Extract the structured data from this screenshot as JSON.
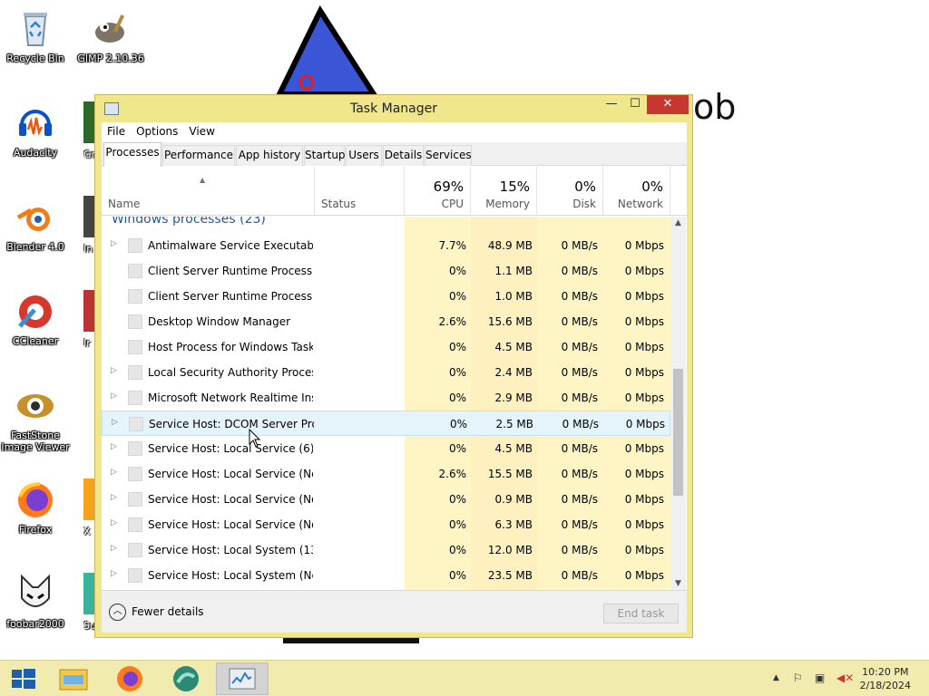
{
  "desktop": {
    "icons": [
      {
        "label": "Recycle Bin"
      },
      {
        "label": "GIMP 2.10.36"
      },
      {
        "label": "Audacity"
      },
      {
        "label": "Blender 4.0"
      },
      {
        "label": "CCleaner"
      },
      {
        "label": "FastStone Image Viewer"
      },
      {
        "label": "Firefox"
      },
      {
        "label": "foobar2000"
      }
    ],
    "partial_labels": [
      "Gr",
      "In",
      "Ir",
      "X",
      "Sup"
    ],
    "background_text": "ob"
  },
  "window": {
    "title": "Task Manager",
    "controls": {
      "minimize": "—",
      "maximize": "☐",
      "close": "✕"
    },
    "menu": [
      "File",
      "Options",
      "View"
    ],
    "tabs": [
      "Processes",
      "Performance",
      "App history",
      "Startup",
      "Users",
      "Details",
      "Services"
    ],
    "active_tab": "Processes",
    "columns": {
      "name": "Name",
      "status": "Status",
      "cpu": {
        "pct": "69%",
        "label": "CPU"
      },
      "memory": {
        "pct": "15%",
        "label": "Memory"
      },
      "disk": {
        "pct": "0%",
        "label": "Disk"
      },
      "network": {
        "pct": "0%",
        "label": "Network"
      }
    },
    "group_title": "Windows processes (23)",
    "processes": [
      {
        "name": "Antimalware Service Executable",
        "expand": true,
        "cpu": "7.7%",
        "mem": "48.9 MB",
        "disk": "0 MB/s",
        "net": "0 Mbps"
      },
      {
        "name": "Client Server Runtime Process",
        "expand": false,
        "cpu": "0%",
        "mem": "1.1 MB",
        "disk": "0 MB/s",
        "net": "0 Mbps"
      },
      {
        "name": "Client Server Runtime Process",
        "expand": false,
        "cpu": "0%",
        "mem": "1.0 MB",
        "disk": "0 MB/s",
        "net": "0 Mbps"
      },
      {
        "name": "Desktop Window Manager",
        "expand": false,
        "cpu": "2.6%",
        "mem": "15.6 MB",
        "disk": "0 MB/s",
        "net": "0 Mbps"
      },
      {
        "name": "Host Process for Windows Tasks",
        "expand": false,
        "cpu": "0%",
        "mem": "4.5 MB",
        "disk": "0 MB/s",
        "net": "0 Mbps"
      },
      {
        "name": "Local Security Authority Process",
        "expand": true,
        "cpu": "0%",
        "mem": "2.4 MB",
        "disk": "0 MB/s",
        "net": "0 Mbps"
      },
      {
        "name": "Microsoft Network Realtime Ins...",
        "expand": true,
        "cpu": "0%",
        "mem": "2.9 MB",
        "disk": "0 MB/s",
        "net": "0 Mbps"
      },
      {
        "name": "Service Host: DCOM Server Proc...",
        "expand": true,
        "cpu": "0%",
        "mem": "2.5 MB",
        "disk": "0 MB/s",
        "net": "0 Mbps"
      },
      {
        "name": "Service Host: Local Service (6)",
        "expand": true,
        "cpu": "0%",
        "mem": "4.5 MB",
        "disk": "0 MB/s",
        "net": "0 Mbps"
      },
      {
        "name": "Service Host: Local Service (Net...",
        "expand": true,
        "cpu": "2.6%",
        "mem": "15.5 MB",
        "disk": "0 MB/s",
        "net": "0 Mbps"
      },
      {
        "name": "Service Host: Local Service (No I...",
        "expand": true,
        "cpu": "0%",
        "mem": "0.9 MB",
        "disk": "0 MB/s",
        "net": "0 Mbps"
      },
      {
        "name": "Service Host: Local Service (No ...",
        "expand": true,
        "cpu": "0%",
        "mem": "6.3 MB",
        "disk": "0 MB/s",
        "net": "0 Mbps"
      },
      {
        "name": "Service Host: Local System (13)",
        "expand": true,
        "cpu": "0%",
        "mem": "12.0 MB",
        "disk": "0 MB/s",
        "net": "0 Mbps"
      },
      {
        "name": "Service Host: Local System (Net...",
        "expand": true,
        "cpu": "0%",
        "mem": "23.5 MB",
        "disk": "0 MB/s",
        "net": "0 Mbps"
      }
    ],
    "selected_row": "Service Host: DCOM Server Proc...",
    "footer": {
      "fewer_details": "Fewer details",
      "end_task": "End task"
    }
  },
  "taskbar": {
    "items": [
      "start-icon",
      "file-explorer-icon",
      "firefox-icon",
      "app-icon",
      "task-manager-icon"
    ],
    "clock": {
      "time": "10:20 PM",
      "date": "2/18/2024"
    }
  },
  "colors": {
    "window_frame": "#f0e68c",
    "close_button": "#c7372f",
    "heat_light": "#fff4c4",
    "heat_medium": "#ffe9a8",
    "group_title": "#1e5aa8",
    "taskbar": "#f2ebb0"
  }
}
